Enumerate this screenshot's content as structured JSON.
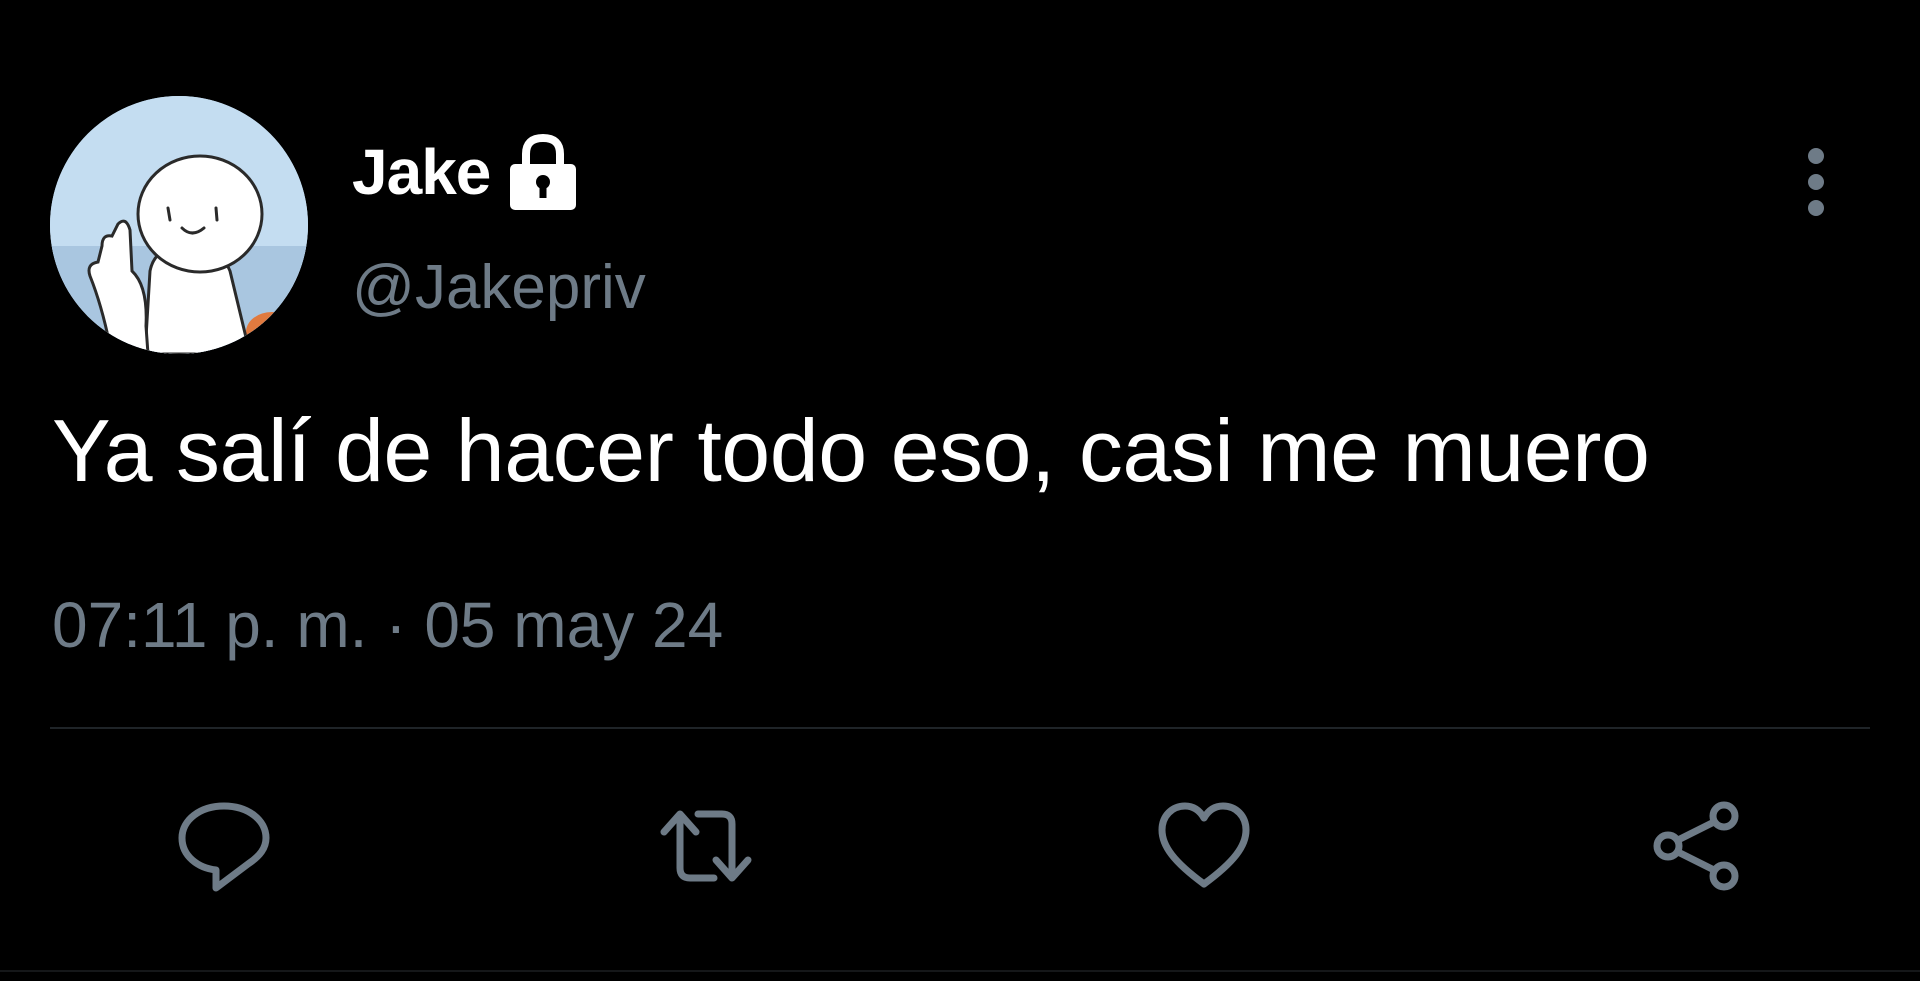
{
  "tweet": {
    "display_name": "Jake",
    "handle": "@Jakepriv",
    "text": "Ya salí de hacer todo eso, casi me muero",
    "timestamp": "07:11 p. m. · 05 may 24"
  },
  "icons": {
    "lock": "lock-icon",
    "more": "more-vertical-icon",
    "reply": "reply-icon",
    "retweet": "retweet-icon",
    "like": "heart-icon",
    "share": "share-icon"
  },
  "colors": {
    "background": "#000000",
    "primary_text": "#ffffff",
    "secondary_text": "#6e7b87",
    "icon": "#6e7b87",
    "divider": "#1f2428"
  }
}
